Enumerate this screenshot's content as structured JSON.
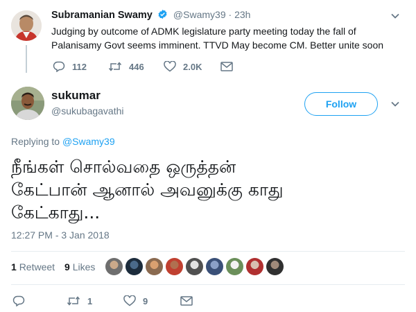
{
  "parent_tweet": {
    "display_name": "Subramanian Swamy",
    "handle": "@Swamy39",
    "separator": "·",
    "time": "23h",
    "text_line1": "Judging by outcome of ADMK legislature party meeting today the fall of",
    "text_line2": "Palanisamy Govt seems imminent. TTVD May become CM. Better unite soon",
    "replies": "112",
    "retweets": "446",
    "likes": "2.0K"
  },
  "main_tweet": {
    "display_name": "sukumar",
    "handle": "@sukubagavathi",
    "follow_label": "Follow",
    "replying_prefix": "Replying to",
    "replying_handle": "@Swamy39",
    "text_line1": "நீங்கள் சொல்வதை ஒருத்தன்",
    "text_line2": "கேட்பான் ஆனால் அவனுக்கு காது",
    "text_line3": "கேட்காது...",
    "timestamp": "12:27 PM - 3 Jan 2018",
    "retweet_count": "1",
    "retweet_label": "Retweet",
    "like_count": "9",
    "like_label": "Likes",
    "action_retweets": "1",
    "action_likes": "9"
  },
  "colors": {
    "accent": "#1da1f2",
    "muted": "#657786",
    "text": "#14171a",
    "line": "#e6ecf0"
  },
  "icons": [
    "verified-badge-icon",
    "chevron-down-icon",
    "reply-icon",
    "retweet-icon",
    "like-icon",
    "message-icon"
  ]
}
